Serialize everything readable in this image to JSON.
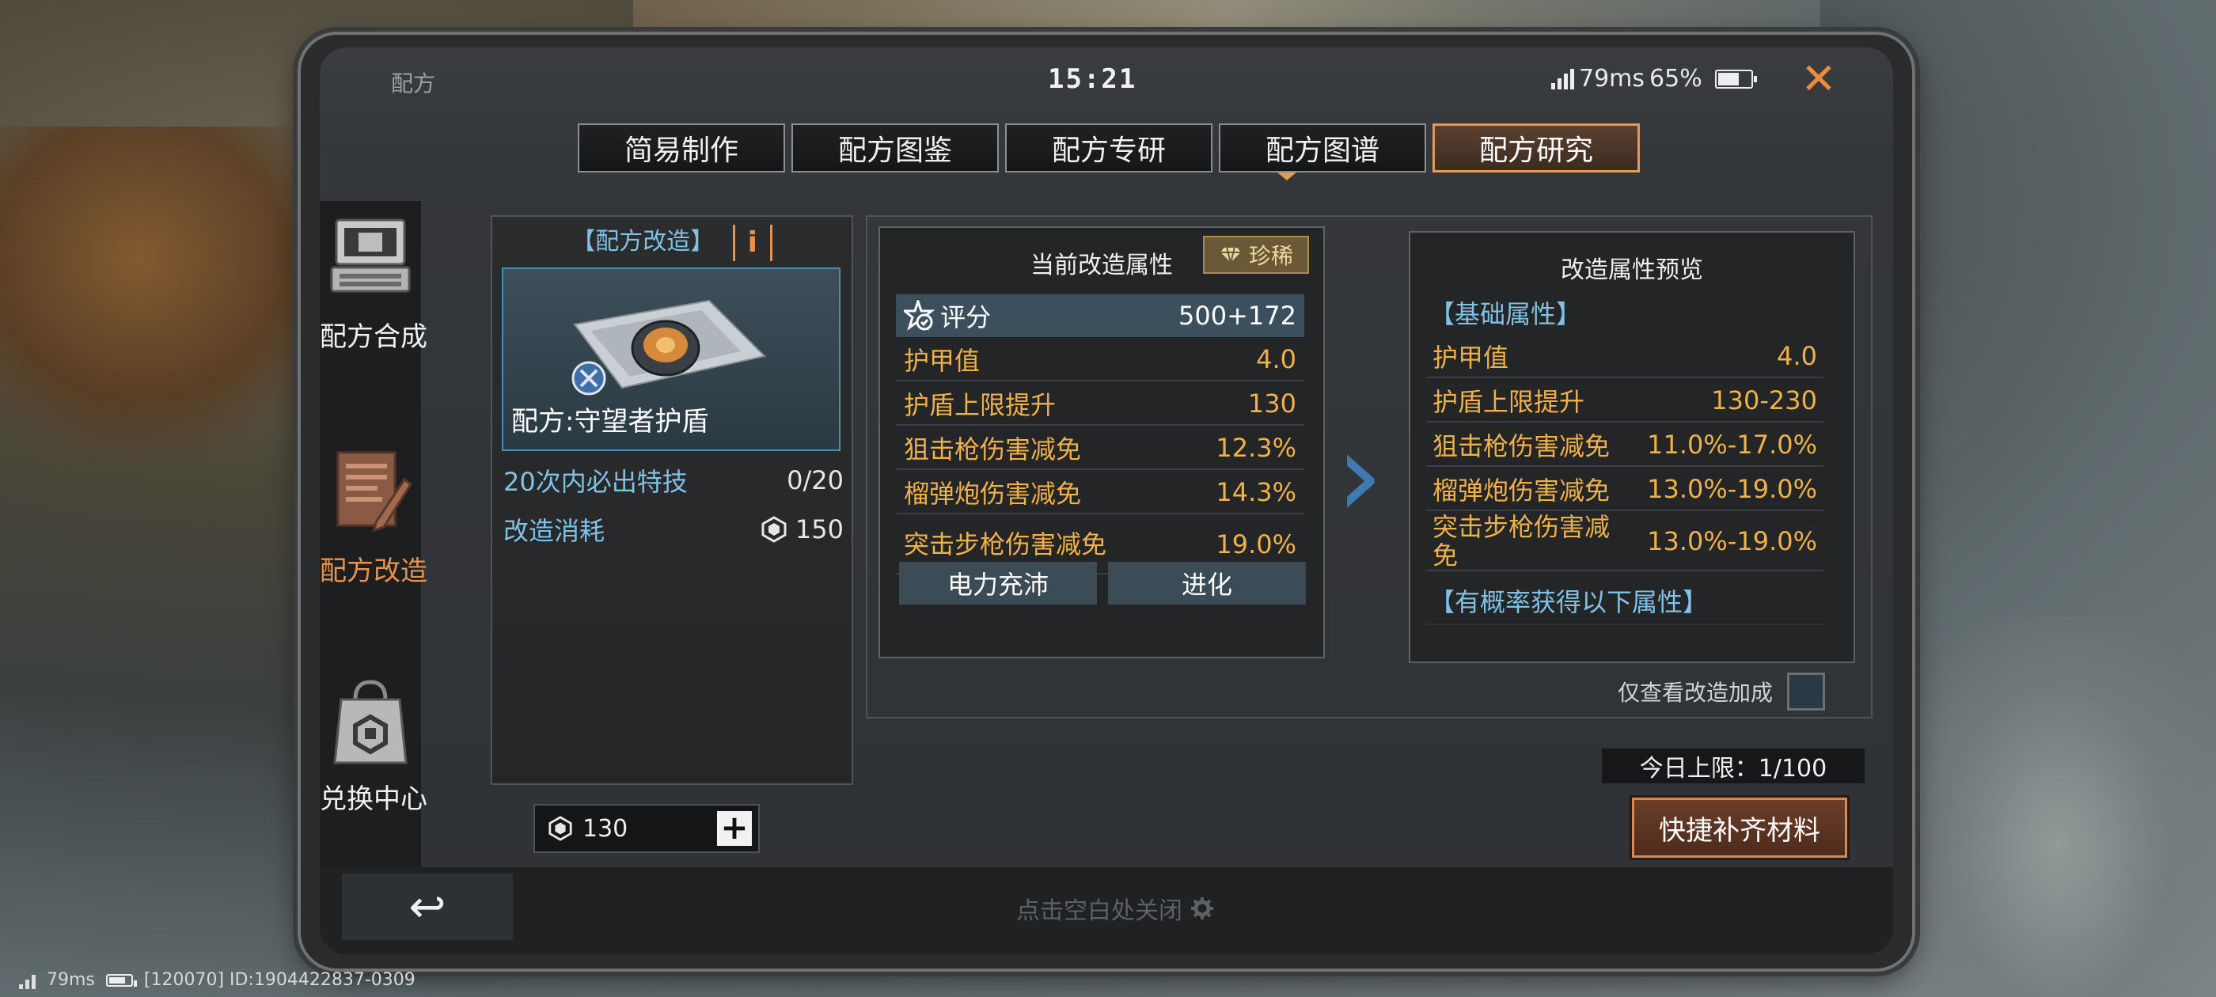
{
  "window": {
    "title": "配方",
    "clock": "15:21",
    "ping": "79ms",
    "battery": "65%"
  },
  "tabs": [
    {
      "label": "简易制作",
      "active": false
    },
    {
      "label": "配方图鉴",
      "active": false
    },
    {
      "label": "配方专研",
      "active": false
    },
    {
      "label": "配方图谱",
      "active": false
    },
    {
      "label": "配方研究",
      "active": true
    }
  ],
  "sidebar": [
    {
      "label": "配方合成",
      "icon": "computer-terminal-icon",
      "active": false
    },
    {
      "label": "配方改造",
      "icon": "document-pen-icon",
      "active": true
    },
    {
      "label": "兑换中心",
      "icon": "shopping-bag-icon",
      "active": false
    }
  ],
  "recipe_card": {
    "header": "【配方改造】",
    "info_label": "i",
    "item_name": "配方:守望者护盾",
    "guarantee_label": "20次内必出特技",
    "guarantee_value": "0/20",
    "cost_label": "改造消耗",
    "cost_value": "150"
  },
  "stepper": {
    "value": "130",
    "plus": "+"
  },
  "current_attrs": {
    "title": "当前改造属性",
    "rarity": "珍稀",
    "score_label": "评分",
    "score_value": "500+172",
    "rows": [
      {
        "name": "护甲值",
        "value": "4.0"
      },
      {
        "name": "护盾上限提升",
        "value": "130"
      },
      {
        "name": "狙击枪伤害减免",
        "value": "12.3%"
      },
      {
        "name": "榴弹炮伤害减免",
        "value": "14.3%"
      },
      {
        "name": "突击步枪伤害减免",
        "value": "19.0%"
      }
    ],
    "buttons": [
      "电力充沛",
      "进化"
    ]
  },
  "preview": {
    "title": "改造属性预览",
    "section_basic": "【基础属性】",
    "rows": [
      {
        "name": "护甲值",
        "value": "4.0"
      },
      {
        "name": "护盾上限提升",
        "value": "130-230"
      },
      {
        "name": "狙击枪伤害减免",
        "value": "11.0%-17.0%"
      },
      {
        "name": "榴弹炮伤害减免",
        "value": "13.0%-19.0%"
      },
      {
        "name": "突击步枪伤害减免",
        "value": "13.0%-19.0%"
      }
    ],
    "section_chance": "【有概率获得以下属性】"
  },
  "only_view_label": "仅查看改造加成",
  "daily_limit": "今日上限：1/100",
  "quick_fill_label": "快捷补齐材料",
  "back_label": "↩",
  "close_hint": "点击空白处关闭",
  "footer": {
    "ping": "79ms",
    "id": "[120070] ID:1904422837-0309"
  },
  "colors": {
    "accent_orange": "#e9914f",
    "attr_gold": "#f0b04a",
    "info_blue": "#7fc2e6",
    "arrow_blue": "#3f7ab0"
  }
}
